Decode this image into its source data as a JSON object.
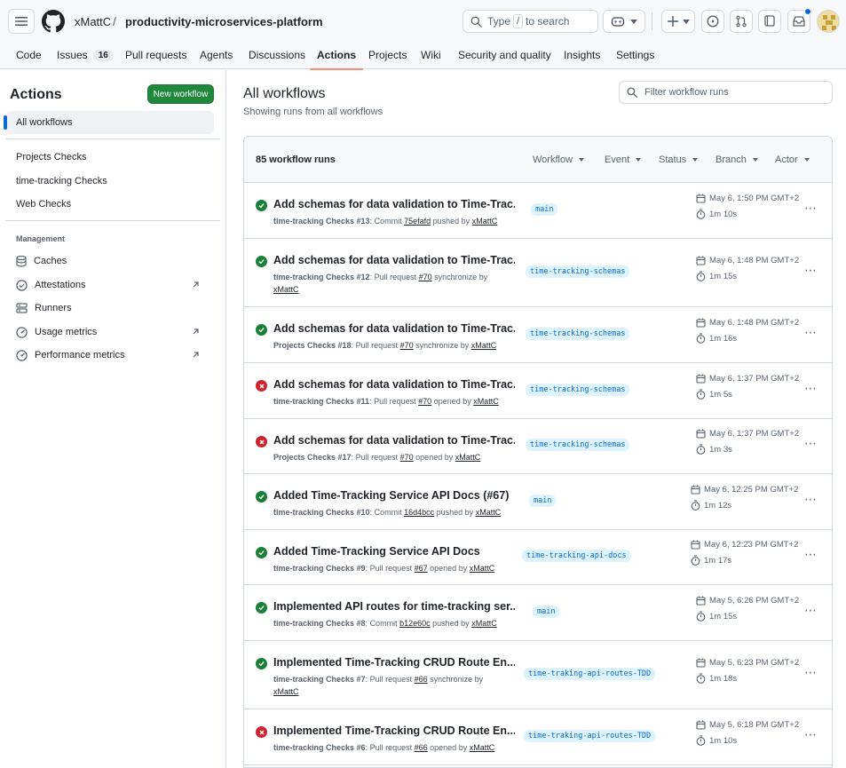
{
  "header": {
    "owner": "xMattC",
    "separator": "/",
    "repo": "productivity-microservices-platform",
    "search_prefix": "Type",
    "search_key": "/",
    "search_suffix": "to search"
  },
  "nav": [
    {
      "label": "Code"
    },
    {
      "label": "Issues",
      "count": "16"
    },
    {
      "label": "Pull requests"
    },
    {
      "label": "Agents"
    },
    {
      "label": "Discussions"
    },
    {
      "label": "Actions",
      "active": true
    },
    {
      "label": "Projects"
    },
    {
      "label": "Wiki"
    },
    {
      "label": "Security and quality"
    },
    {
      "label": "Insights"
    },
    {
      "label": "Settings"
    }
  ],
  "sidebar": {
    "title": "Actions",
    "new_workflow": "New workflow",
    "all_workflows": "All workflows",
    "workflows": [
      "Projects Checks",
      "time-tracking Checks",
      "Web Checks"
    ],
    "management_heading": "Management",
    "management": [
      "Caches",
      "Attestations",
      "Runners",
      "Usage metrics",
      "Performance metrics"
    ]
  },
  "main": {
    "title": "All workflows",
    "subtitle": "Showing runs from all workflows",
    "filter_placeholder": "Filter workflow runs",
    "runs_count": "85 workflow runs",
    "filters": [
      "Workflow",
      "Event",
      "Status",
      "Branch",
      "Actor"
    ]
  },
  "runs": [
    {
      "status": "success",
      "title": "Add schemas for data validation to Time-Trac...",
      "workflow": "time-tracking Checks #13",
      "trigger": "Commit",
      "ref": "75efafd",
      "action": "pushed by",
      "user": "xMattC",
      "branch": "main",
      "date": "May 6, 1:50 PM GMT+2",
      "duration": "1m 10s"
    },
    {
      "status": "success",
      "title": "Add schemas for data validation to Time-Trac...",
      "workflow": "time-tracking Checks #12",
      "trigger": "Pull request",
      "ref": "#70",
      "action": "synchronize by",
      "user": "xMattC",
      "branch": "time-tracking-schemas",
      "date": "May 6, 1:48 PM GMT+2",
      "duration": "1m 15s"
    },
    {
      "status": "success",
      "title": "Add schemas for data validation to Time-Trac...",
      "workflow": "Projects Checks #18",
      "trigger": "Pull request",
      "ref": "#70",
      "action": "synchronize by",
      "user": "xMattC",
      "branch": "time-tracking-schemas",
      "date": "May 6, 1:48 PM GMT+2",
      "duration": "1m 16s"
    },
    {
      "status": "failure",
      "title": "Add schemas for data validation to Time-Trac...",
      "workflow": "time-tracking Checks #11",
      "trigger": "Pull request",
      "ref": "#70",
      "action": "opened by",
      "user": "xMattC",
      "branch": "time-tracking-schemas",
      "date": "May 6, 1:37 PM GMT+2",
      "duration": "1m 5s"
    },
    {
      "status": "failure",
      "title": "Add schemas for data validation to Time-Trac...",
      "workflow": "Projects Checks #17",
      "trigger": "Pull request",
      "ref": "#70",
      "action": "opened by",
      "user": "xMattC",
      "branch": "time-tracking-schemas",
      "date": "May 6, 1:37 PM GMT+2",
      "duration": "1m 3s"
    },
    {
      "status": "success",
      "title": "Added Time-Tracking Service API Docs (#67)",
      "workflow": "time-tracking Checks #10",
      "trigger": "Commit",
      "ref": "16d4bcc",
      "action": "pushed by",
      "user": "xMattC",
      "branch": "main",
      "date": "May 6, 12:25 PM GMT+2",
      "duration": "1m 12s"
    },
    {
      "status": "success",
      "title": "Added Time-Tracking Service API Docs",
      "workflow": "time-tracking Checks #9",
      "trigger": "Pull request",
      "ref": "#67",
      "action": "opened by",
      "user": "xMattC",
      "branch": "time-tracking-api-docs",
      "date": "May 6, 12:23 PM GMT+2",
      "duration": "1m 17s"
    },
    {
      "status": "success",
      "title": "Implemented API routes for time-tracking ser...",
      "workflow": "time-tracking Checks #8",
      "trigger": "Commit",
      "ref": "b12e60c",
      "action": "pushed by",
      "user": "xMattC",
      "branch": "main",
      "date": "May 5, 6:26 PM GMT+2",
      "duration": "1m 15s"
    },
    {
      "status": "success",
      "title": "Implemented Time-Tracking CRUD Route En...",
      "workflow": "time-tracking Checks #7",
      "trigger": "Pull request",
      "ref": "#66",
      "action": "synchronize by",
      "user": "xMattC",
      "branch": "time-traking-api-routes-TDD",
      "date": "May 5, 6:23 PM GMT+2",
      "duration": "1m 18s"
    },
    {
      "status": "failure",
      "title": "Implemented Time-Tracking CRUD Route En...",
      "workflow": "time-tracking Checks #6",
      "trigger": "Pull request",
      "ref": "#66",
      "action": "opened by",
      "user": "xMattC",
      "branch": "time-traking-api-routes-TDD",
      "date": "May 5, 6:18 PM GMT+2",
      "duration": "1m 10s"
    }
  ],
  "colors": {
    "success": "#1a7f37",
    "failure": "#cf222e",
    "accent": "#0969da",
    "primary_button": "#1f883d",
    "active_tab_underline": "#fd8c73"
  }
}
